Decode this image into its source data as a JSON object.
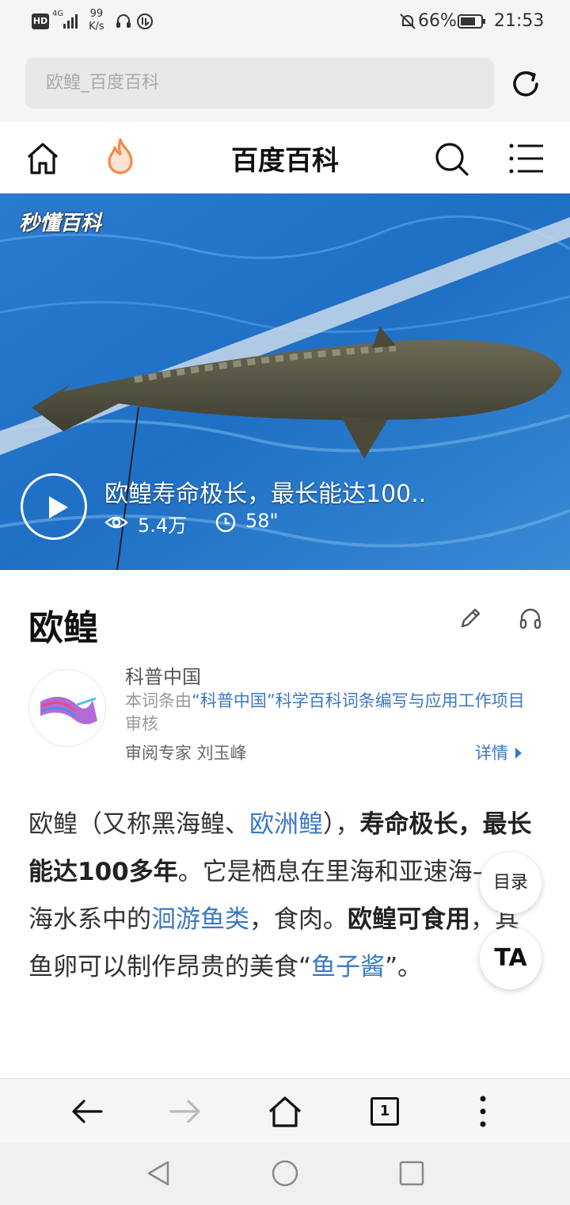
{
  "status_bar": {
    "hd": "HD",
    "network": "4G",
    "speed_value": "99",
    "speed_unit": "K/s",
    "battery_percent": "66%",
    "time": "21:53"
  },
  "browser": {
    "url_placeholder": "欧鳇_百度百科"
  },
  "site_nav": {
    "title": "百度百科"
  },
  "video": {
    "watermark": "秒懂百科",
    "title": "欧鳇寿命极长，最长能达100..",
    "views": "5.4万",
    "duration": "58\""
  },
  "entry": {
    "title": "欧鳇"
  },
  "reviewer": {
    "org_name": "科普中国",
    "desc_prefix": "本词条由",
    "desc_link": "“科普中国”科学百科词条编写与应用工作项目",
    "desc_suffix": "审核",
    "expert": "审阅专家 刘玉峰",
    "details": "详情"
  },
  "summary": {
    "p1": "欧鳇（又称黑海鳇、",
    "link1": "欧洲鳇",
    "p2": "），",
    "b1": "寿命极长，最长能达100多年",
    "p3": "。它是栖息在里海和亚速海—黑海水系中的",
    "link2": "洄游鱼类",
    "p4": "，食肉。",
    "b2": "欧鳇可食用",
    "p5": "，其鱼卵可以制作昂贵的美食“",
    "link3": "鱼子酱",
    "p6": "”。"
  },
  "floating": {
    "toc": "目录",
    "font": "TA"
  },
  "toolbar": {
    "tab_count": "1"
  },
  "colors": {
    "link": "#3b78c2",
    "hot_orange": "#f5894a",
    "water_blue": "#1f6fc4"
  }
}
